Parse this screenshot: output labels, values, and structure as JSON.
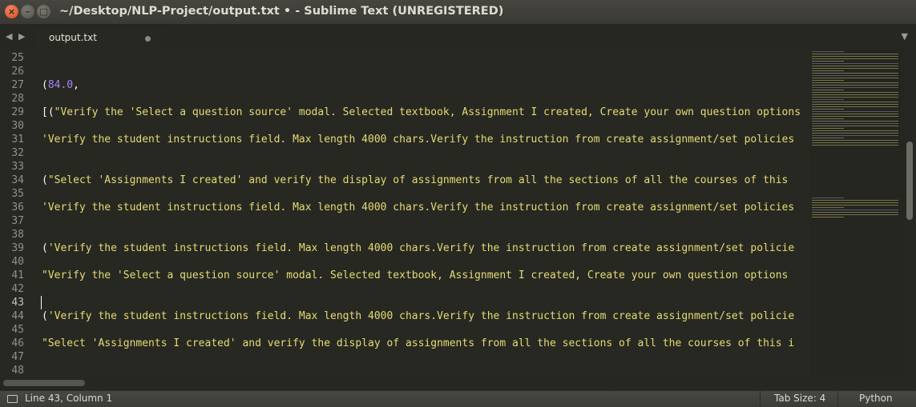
{
  "window": {
    "title": "~/Desktop/NLP-Project/output.txt • - Sublime Text (UNREGISTERED)",
    "close_glyph": "×",
    "minimize_glyph": "–",
    "maximize_glyph": "□"
  },
  "tabbar": {
    "back_glyph": "◀",
    "forward_glyph": "▶",
    "tab_label": "output.txt",
    "dropdown_glyph": "▼"
  },
  "editor": {
    "active_line": 43,
    "lines": [
      {
        "n": "25",
        "text": ""
      },
      {
        "n": "26",
        "text": ""
      },
      {
        "n": "27",
        "text": "(84.0,"
      },
      {
        "n": "28",
        "text": ""
      },
      {
        "n": "29",
        "text": "[(\"Verify the 'Select a question source' modal. Selected textbook, Assignment I created, Create your own question options"
      },
      {
        "n": "30",
        "text": ""
      },
      {
        "n": "31",
        "text": "'Verify the student instructions field. Max length 4000 chars.Verify the instruction from create assignment/set policies"
      },
      {
        "n": "32",
        "text": ""
      },
      {
        "n": "33",
        "text": ""
      },
      {
        "n": "34",
        "text": "(\"Select 'Assignments I created' and verify the display of assignments from all the sections of all the courses of this"
      },
      {
        "n": "35",
        "text": ""
      },
      {
        "n": "36",
        "text": "'Verify the student instructions field. Max length 4000 chars.Verify the instruction from create assignment/set policies"
      },
      {
        "n": "37",
        "text": ""
      },
      {
        "n": "38",
        "text": ""
      },
      {
        "n": "39",
        "text": "('Verify the student instructions field. Max length 4000 chars.Verify the instruction from create assignment/set policie"
      },
      {
        "n": "40",
        "text": ""
      },
      {
        "n": "41",
        "text": "\"Verify the 'Select a question source' modal. Selected textbook, Assignment I created, Create your own question options"
      },
      {
        "n": "42",
        "text": ""
      },
      {
        "n": "43",
        "text": ""
      },
      {
        "n": "44",
        "text": "('Verify the student instructions field. Max length 4000 chars.Verify the instruction from create assignment/set policie"
      },
      {
        "n": "45",
        "text": ""
      },
      {
        "n": "46",
        "text": "\"Select 'Assignments I created' and verify the display of assignments from all the sections of all the courses of this i"
      },
      {
        "n": "47",
        "text": ""
      },
      {
        "n": "48",
        "text": ""
      }
    ]
  },
  "statusbar": {
    "position": "Line 43, Column 1",
    "tab_size": "Tab Size: 4",
    "syntax": "Python"
  },
  "colors": {
    "background": "#272822",
    "string": "#e6db74",
    "number": "#ae81ff",
    "punctuation": "#f8f8f2",
    "line_number": "#8f908a",
    "close_button": "#e0562a"
  }
}
